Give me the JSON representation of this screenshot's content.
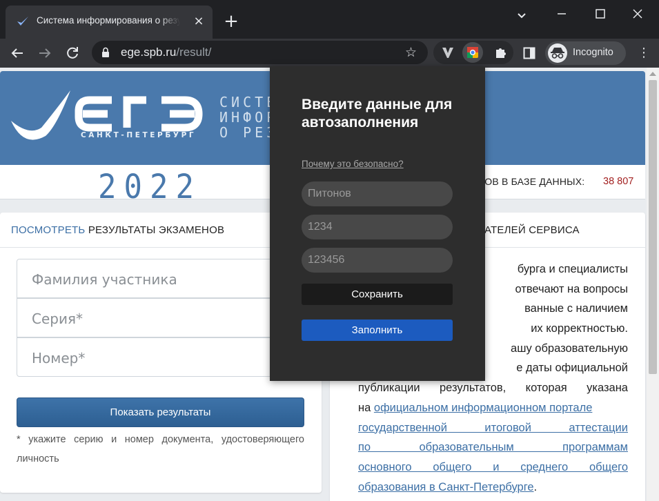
{
  "browser": {
    "tab_title": "Система информирования о результатах ЕГЭ",
    "url_host": "ege.spb.ru",
    "url_path": "/result/",
    "profile_label": "Incognito"
  },
  "header": {
    "logo_word": "ЕГЭ",
    "logo_subtitle": "САНКТ-ПЕТЕРБУРГ",
    "system_lines": [
      "СИСТЕМ",
      "ИНФОРМ",
      "О РЕЗУ"
    ],
    "year": "2022",
    "count_label": "ЛЬТАТОВ В БАЗЕ ДАННЫХ:",
    "count_value": "38 807"
  },
  "left_card": {
    "title_accent": "ПОСМОТРЕТЬ",
    "title_rest": " РЕЗУЛЬТАТЫ ЭКЗАМЕНОВ",
    "surname_placeholder": "Фамилия участника",
    "series_placeholder": "Серия*",
    "number_placeholder": "Номер*",
    "submit_label": "Показать результаты",
    "footnote": "* укажите серию и номер документа, удостоверяющего личность"
  },
  "right_card": {
    "title_partial": "АТЕЛЕЙ СЕРВИСА",
    "lines": [
      "бурга и специалисты",
      "отвечают на вопросы",
      "ванные с наличием",
      "их корректностью.",
      "ашу образовательную",
      "е даты официальной",
      "публикации результатов, которая указана",
      "на",
      "официальном информационном портале",
      "государственной итоговой аттестации",
      "по образовательным программам",
      "основного общего и среднего общего",
      "образования в Санкт-Петербурге",
      "."
    ]
  },
  "popup": {
    "title": "Введите данные для автозаполнения",
    "safety_link": "Почему это безопасно?",
    "field1_value": "Питонов",
    "field2_value": "1234",
    "field3_value": "123456",
    "save_label": "Сохранить",
    "fill_label": "Заполнить"
  },
  "icons": [
    "ege-favicon",
    "close-icon",
    "plus-icon",
    "chevron-down-icon",
    "minimize-icon",
    "maximize-icon",
    "close-window-icon",
    "back-icon",
    "forward-icon",
    "reload-icon",
    "lock-icon",
    "star-icon",
    "v-extension-icon",
    "chrome-extension-icon",
    "puzzle-icon",
    "side-panel-icon",
    "incognito-icon",
    "menu-dots-icon"
  ]
}
